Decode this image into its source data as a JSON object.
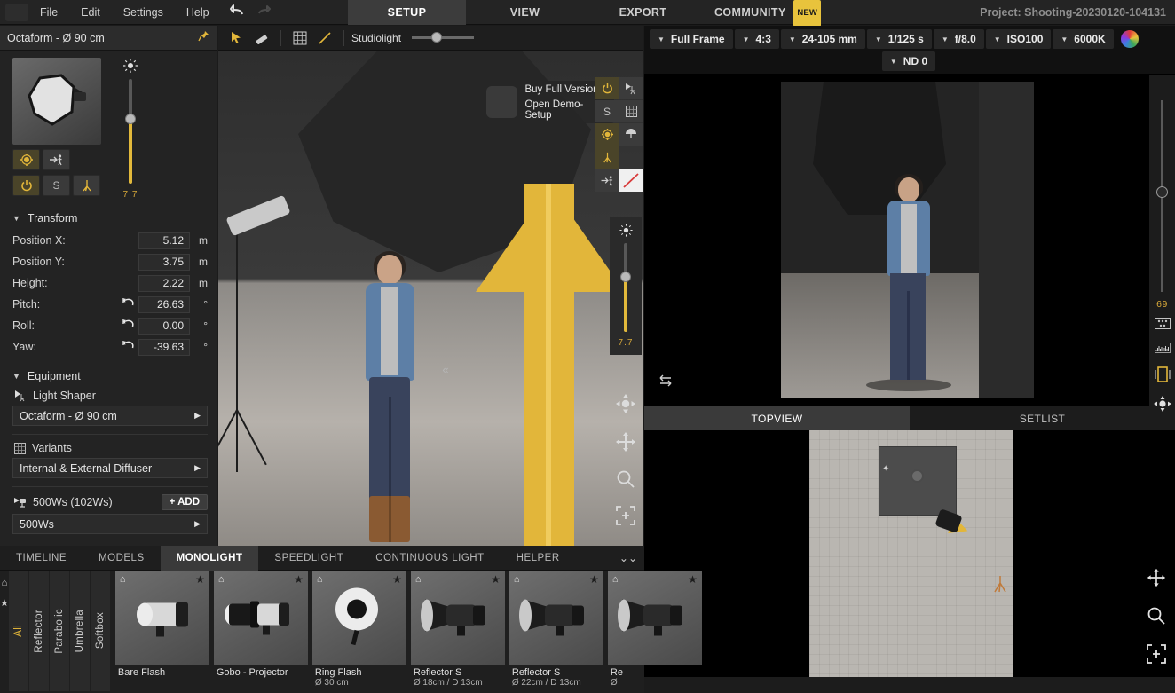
{
  "menubar": {
    "logo_icon": "app-logo-icon",
    "items": [
      "File",
      "Edit",
      "Settings",
      "Help"
    ],
    "undo_icon": "undo-icon",
    "redo_icon": "redo-icon"
  },
  "toptabs": {
    "items": [
      {
        "label": "SETUP",
        "active": true
      },
      {
        "label": "VIEW",
        "active": false
      },
      {
        "label": "EXPORT",
        "active": false
      },
      {
        "label": "COMMUNITY",
        "active": false,
        "badge": "NEW"
      }
    ],
    "project": "Project: Shooting-20230120-104131"
  },
  "leftpanel": {
    "title": "Octaform - Ø 90 cm",
    "pin_icon": "pin-icon",
    "thumb_icon": "softbox-thumbnail",
    "buttons": [
      {
        "name": "target-button",
        "glyph": "⌖",
        "state": "on"
      },
      {
        "name": "point-at-model-button",
        "glyph": "→",
        "state": "off"
      },
      {
        "name": "power-button",
        "glyph": "⏻",
        "state": "on"
      },
      {
        "name": "solo-button",
        "glyph": "S",
        "state": "off"
      },
      {
        "name": "stand-button",
        "glyph": "⑂",
        "state": "on"
      }
    ],
    "intensity": {
      "icon": "sun-icon",
      "value": "7.7",
      "fill_percent": 62
    },
    "transform": {
      "title": "Transform",
      "rows": [
        {
          "label": "Position X:",
          "value": "5.12",
          "unit": "m",
          "reset": false
        },
        {
          "label": "Position Y:",
          "value": "3.75",
          "unit": "m",
          "reset": false
        },
        {
          "label": "Height:",
          "value": "2.22",
          "unit": "m",
          "reset": false
        },
        {
          "label": "Pitch:",
          "value": "26.63",
          "unit": "°",
          "reset": true
        },
        {
          "label": "Roll:",
          "value": "0.00",
          "unit": "°",
          "reset": true
        },
        {
          "label": "Yaw:",
          "value": "-39.63",
          "unit": "°",
          "reset": true
        }
      ]
    },
    "equipment": {
      "title": "Equipment",
      "light_shaper_label": "Light Shaper",
      "light_shaper_value": "Octaform - Ø 90 cm",
      "variants_label": "Variants",
      "variants_value": "Internal & External Diffuser",
      "power_label": "500Ws (102Ws)",
      "add_label": "ADD",
      "power_value": "500Ws"
    }
  },
  "viewport": {
    "tools": [
      {
        "name": "select-tool-icon",
        "glyph": "➤"
      },
      {
        "name": "measure-tool-icon",
        "glyph": "✐"
      },
      {
        "name": "grid-toggle-icon",
        "glyph": "▦"
      },
      {
        "name": "line-tool-icon",
        "glyph": "╱"
      }
    ],
    "studiolight_label": "Studiolight",
    "studiolight_percent": 50,
    "promo": {
      "icon": "app-logo-icon",
      "line1": "Buy Full Version",
      "line2": "Open Demo-Setup"
    },
    "right_tools": [
      {
        "name": "power-button",
        "glyph": "⏻",
        "state": "on"
      },
      {
        "name": "light-stand-icon",
        "glyph": "⑂",
        "state": "off"
      },
      {
        "name": "solo-button",
        "glyph": "S",
        "state": "off"
      },
      {
        "name": "grid-icon",
        "glyph": "▦",
        "state": "off"
      },
      {
        "name": "target-icon",
        "glyph": "⌖",
        "state": "on"
      },
      {
        "name": "umbrella-icon",
        "glyph": "☂",
        "state": "off"
      },
      {
        "name": "tripod-icon",
        "glyph": "⑁",
        "state": "on"
      },
      {
        "name": "point-at-model-icon",
        "glyph": "→",
        "state": "off"
      },
      {
        "name": "no-light-icon",
        "glyph": "⊘",
        "state": "white"
      }
    ],
    "slider": {
      "icon": "sun-icon",
      "value": "7.7",
      "fill_percent": 62
    },
    "nav_icons": [
      {
        "name": "orbit-icon",
        "glyph": "✥"
      },
      {
        "name": "pan-icon",
        "glyph": "✥"
      },
      {
        "name": "zoom-icon",
        "glyph": "⌕"
      },
      {
        "name": "focus-icon",
        "glyph": "⬚"
      }
    ],
    "collapse_icon": "«"
  },
  "camera": {
    "settings": [
      {
        "name": "sensor-select",
        "value": "Full Frame"
      },
      {
        "name": "aspect-ratio-select",
        "value": "4:3"
      },
      {
        "name": "focal-length-select",
        "value": "24-105 mm"
      },
      {
        "name": "shutter-speed-select",
        "value": "1/125 s"
      },
      {
        "name": "aperture-select",
        "value": "f/8.0"
      },
      {
        "name": "iso-select",
        "value": "ISO100"
      },
      {
        "name": "white-balance-select",
        "value": "6000K"
      }
    ],
    "color_wheel_icon": "color-wheel-icon",
    "nd_filter": {
      "name": "nd-filter-select",
      "value": "ND 0"
    },
    "flip_icon": "flip-view-icon",
    "rail": {
      "value": "69",
      "fill_percent": 45,
      "icons": [
        {
          "name": "grid-overlay-icon",
          "glyph": "▦"
        },
        {
          "name": "histogram-icon",
          "glyph": "▂"
        },
        {
          "name": "portrait-orientation-icon",
          "glyph": "▯"
        },
        {
          "name": "pan-view-icon",
          "glyph": "✥"
        }
      ]
    }
  },
  "lower_right_tabs": [
    {
      "label": "TOPVIEW",
      "active": true
    },
    {
      "label": "SETLIST",
      "active": false
    }
  ],
  "topview": {
    "tools": [
      {
        "name": "pan-icon",
        "glyph": "✥"
      },
      {
        "name": "zoom-icon",
        "glyph": "⌕"
      },
      {
        "name": "focus-icon",
        "glyph": "⬚"
      }
    ]
  },
  "library": {
    "tabs": [
      {
        "label": "TIMELINE",
        "active": false
      },
      {
        "label": "MODELS",
        "active": false
      },
      {
        "label": "MONOLIGHT",
        "active": true
      },
      {
        "label": "SPEEDLIGHT",
        "active": false
      },
      {
        "label": "CONTINUOUS LIGHT",
        "active": false
      },
      {
        "label": "HELPER",
        "active": false
      }
    ],
    "expand_icon": "chevron-double-down-icon",
    "fav_icons": [
      {
        "name": "home-icon",
        "glyph": "⌂"
      },
      {
        "name": "star-icon",
        "glyph": "★"
      }
    ],
    "categories": [
      {
        "label": "All",
        "active": true
      },
      {
        "label": "Reflector",
        "active": false
      },
      {
        "label": "Parabolic",
        "active": false
      },
      {
        "label": "Umbrella",
        "active": false
      },
      {
        "label": "Softbox",
        "active": false
      }
    ],
    "cards": [
      {
        "label": "Bare Flash",
        "sub": "",
        "type": "bare"
      },
      {
        "label": "Gobo - Projector",
        "sub": "",
        "type": "gobo"
      },
      {
        "label": "Ring Flash",
        "sub": "Ø 30 cm",
        "type": "ring"
      },
      {
        "label": "Reflector S",
        "sub": "Ø 18cm / D 13cm",
        "type": "reflector"
      },
      {
        "label": "Reflector S",
        "sub": "Ø 22cm / D 13cm",
        "type": "reflector"
      },
      {
        "label": "Re",
        "sub": "Ø",
        "type": "reflector"
      }
    ]
  },
  "colors": {
    "accent": "#e2b63a",
    "panel": "#232323",
    "bg": "#1b1b1b",
    "active_tab": "#3c3c3c"
  }
}
